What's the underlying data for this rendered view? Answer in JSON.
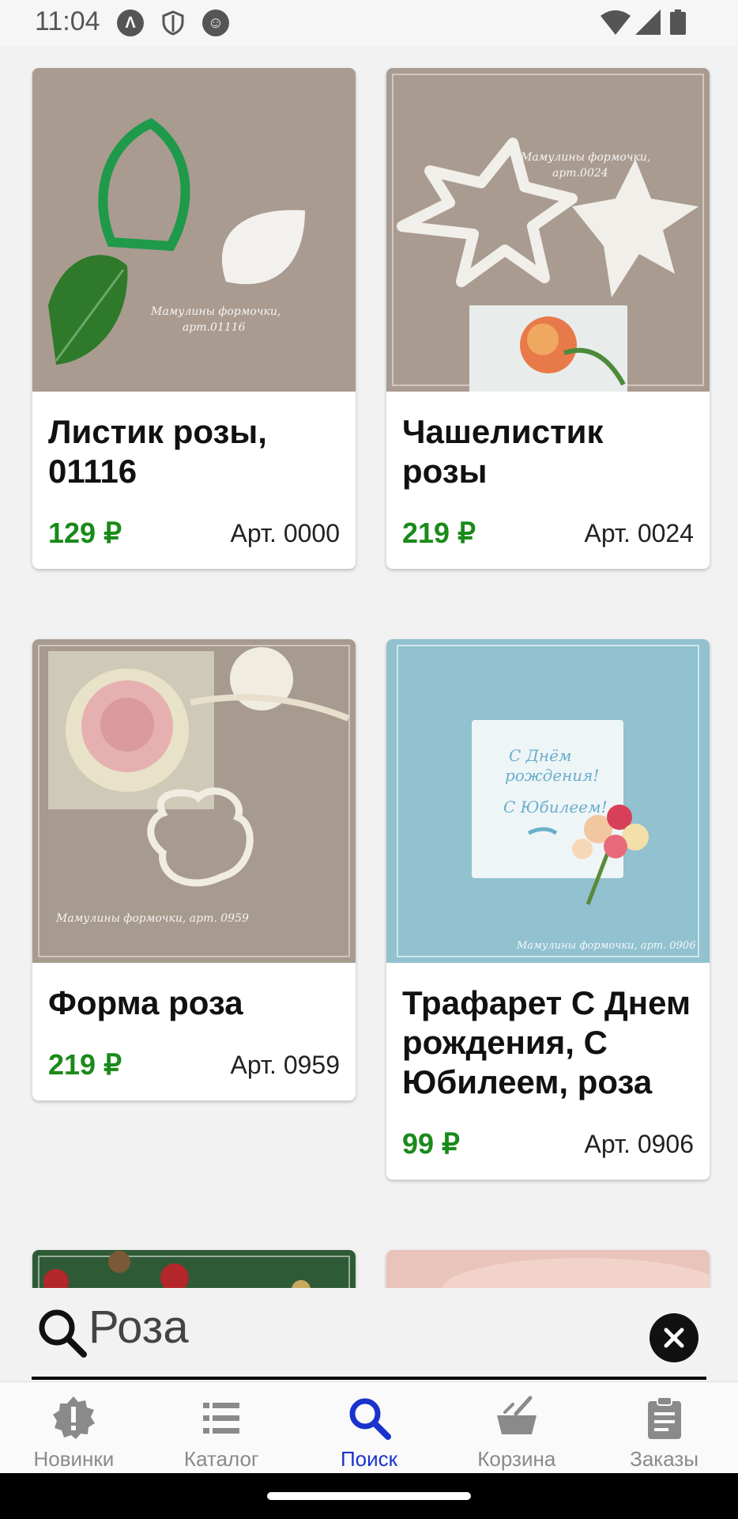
{
  "status_bar": {
    "time": "11:04"
  },
  "products": [
    {
      "title": "Листик розы, 01116",
      "price": "129 ₽",
      "sku": "Арт. 0000",
      "watermark_1": "Мамулины формочки,",
      "watermark_2": "арт.01116"
    },
    {
      "title": "Чашелистик розы",
      "price": "219 ₽",
      "sku": "Арт. 0024",
      "watermark_1": "Мамулины формочки,",
      "watermark_2": "арт.0024"
    },
    {
      "title": "Форма роза",
      "price": "219 ₽",
      "sku": "Арт. 0959",
      "watermark_1": "Мамулины формочки, арт. 0959"
    },
    {
      "title": "Трафарет С Днем рождения, С Юбилеем, роза",
      "price": "99 ₽",
      "sku": "Арт. 0906",
      "watermark_1": "Мамулины формочки, арт. 0906",
      "card_text_1": "С Днём",
      "card_text_2": "рождения!",
      "card_text_3": "С Юбилеем!"
    }
  ],
  "search": {
    "value": "Роза"
  },
  "bottom_nav": [
    {
      "label": "Новинки",
      "icon": "alert-badge-icon"
    },
    {
      "label": "Каталог",
      "icon": "list-icon"
    },
    {
      "label": "Поиск",
      "icon": "search-icon",
      "active": true
    },
    {
      "label": "Корзина",
      "icon": "basket-icon"
    },
    {
      "label": "Заказы",
      "icon": "clipboard-icon"
    }
  ],
  "colors": {
    "price": "#1a8a1a",
    "active_nav": "#1a33cc"
  }
}
